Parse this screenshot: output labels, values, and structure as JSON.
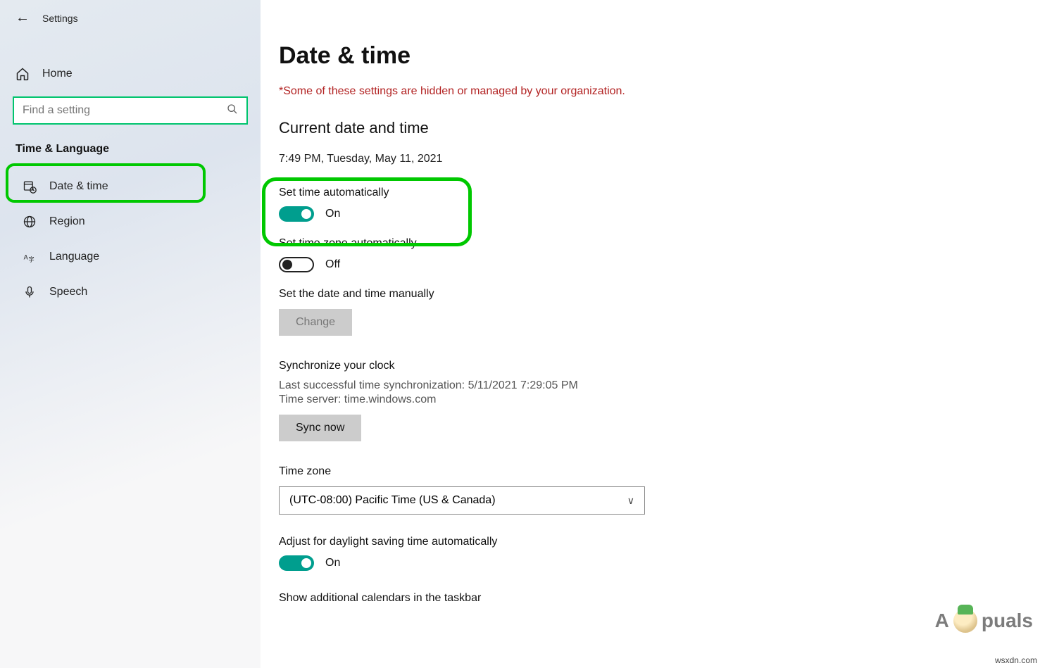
{
  "header": {
    "app": "Settings"
  },
  "sidebar": {
    "home": "Home",
    "search_placeholder": "Find a setting",
    "category": "Time & Language",
    "items": [
      "Date & time",
      "Region",
      "Language",
      "Speech"
    ]
  },
  "main": {
    "title": "Date & time",
    "warning": "*Some of these settings are hidden or managed by your organization.",
    "current_section": "Current date and time",
    "current_value": "7:49 PM, Tuesday, May 11, 2021",
    "set_time_auto": {
      "label": "Set time automatically",
      "state": "On"
    },
    "set_tz_auto": {
      "label": "Set time zone automatically",
      "state": "Off"
    },
    "manual": {
      "label": "Set the date and time manually",
      "button": "Change"
    },
    "sync": {
      "label": "Synchronize your clock",
      "last": "Last successful time synchronization: 5/11/2021 7:29:05 PM",
      "server": "Time server: time.windows.com",
      "button": "Sync now"
    },
    "tz": {
      "label": "Time zone",
      "value": "(UTC-08:00) Pacific Time (US & Canada)"
    },
    "dst": {
      "label": "Adjust for daylight saving time automatically",
      "state": "On"
    },
    "show_cal": "Show additional calendars in the taskbar"
  },
  "watermark": {
    "brand_a": "A",
    "brand_b": "puals",
    "site": "wsxdn.com"
  }
}
